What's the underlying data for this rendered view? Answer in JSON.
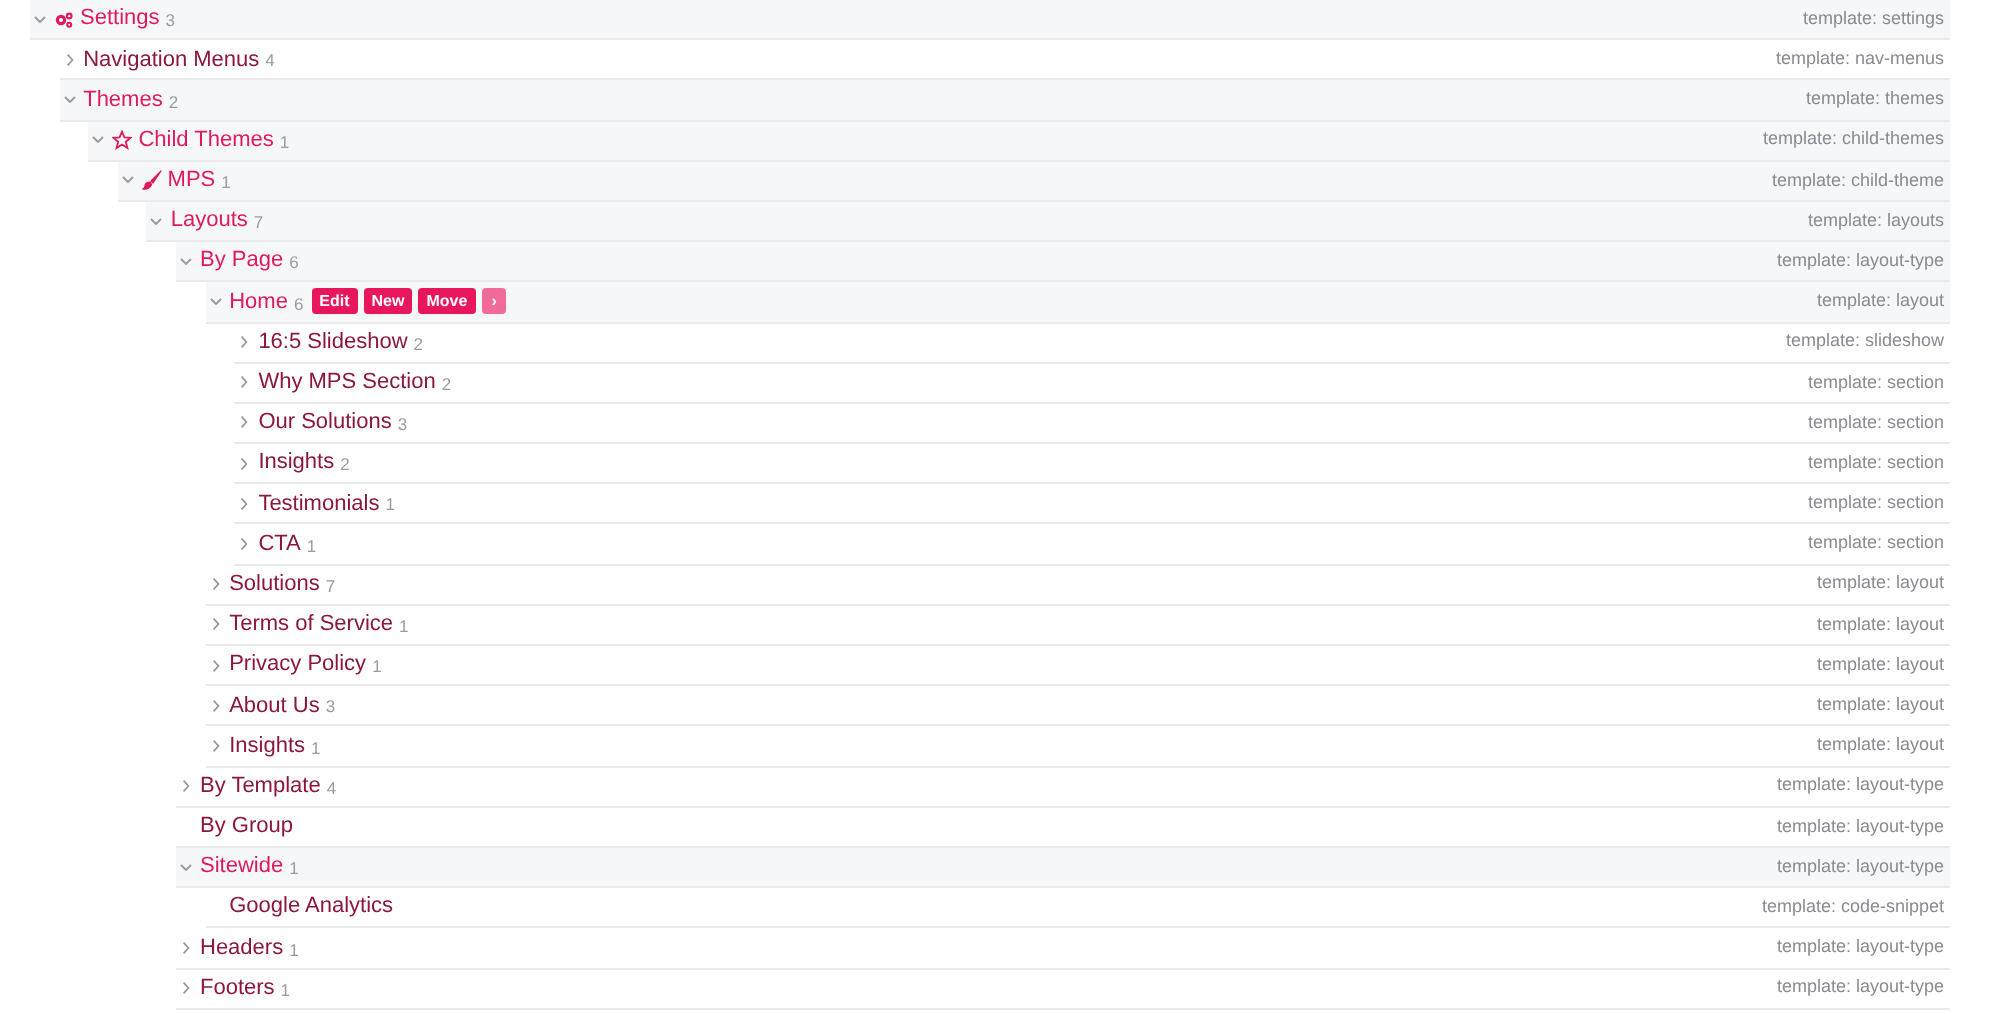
{
  "tree": [
    {
      "label": "Settings",
      "count": "3",
      "template": "template: settings",
      "kind": "gears",
      "expanded": true,
      "children": [
        {
          "label": "Navigation Menus",
          "count": "4",
          "template": "template: nav-menus",
          "kind": "branch",
          "expanded": false
        },
        {
          "label": "Themes",
          "count": "2",
          "template": "template: themes",
          "kind": "branch",
          "expanded": true,
          "children": [
            {
              "label": "Child Themes",
              "count": "1",
              "template": "template: child-themes",
              "kind": "star",
              "expanded": true,
              "children": [
                {
                  "label": "MPS",
                  "count": "1",
                  "template": "template: child-theme",
                  "kind": "brush",
                  "expanded": true,
                  "children": [
                    {
                      "label": "Layouts",
                      "count": "7",
                      "template": "template: layouts",
                      "kind": "branch",
                      "expanded": true,
                      "children": [
                        {
                          "label": "By Page",
                          "count": "6",
                          "template": "template: layout-type",
                          "kind": "branch",
                          "expanded": true,
                          "children": [
                            {
                              "label": "Home",
                              "count": "6",
                              "template": "template: layout",
                              "kind": "branch",
                              "expanded": true,
                              "actions": [
                                {
                                  "label": "Edit",
                                  "kind": "primary"
                                },
                                {
                                  "label": "New",
                                  "kind": "primary"
                                },
                                {
                                  "label": "Move",
                                  "kind": "primary"
                                },
                                {
                                  "label": "›",
                                  "kind": "more"
                                }
                              ],
                              "children": [
                                {
                                  "label": "16:5 Slideshow",
                                  "count": "2",
                                  "template": "template: slideshow",
                                  "kind": "branch",
                                  "expanded": false
                                },
                                {
                                  "label": "Why MPS Section",
                                  "count": "2",
                                  "template": "template: section",
                                  "kind": "branch",
                                  "expanded": false
                                },
                                {
                                  "label": "Our Solutions",
                                  "count": "3",
                                  "template": "template: section",
                                  "kind": "branch",
                                  "expanded": false
                                },
                                {
                                  "label": "Insights",
                                  "count": "2",
                                  "template": "template: section",
                                  "kind": "branch",
                                  "expanded": false
                                },
                                {
                                  "label": "Testimonials",
                                  "count": "1",
                                  "template": "template: section",
                                  "kind": "branch",
                                  "expanded": false
                                },
                                {
                                  "label": "CTA",
                                  "count": "1",
                                  "template": "template: section",
                                  "kind": "branch",
                                  "expanded": false
                                }
                              ]
                            },
                            {
                              "label": "Solutions",
                              "count": "7",
                              "template": "template: layout",
                              "kind": "branch",
                              "expanded": false
                            },
                            {
                              "label": "Terms of Service",
                              "count": "1",
                              "template": "template: layout",
                              "kind": "branch",
                              "expanded": false
                            },
                            {
                              "label": "Privacy Policy",
                              "count": "1",
                              "template": "template: layout",
                              "kind": "branch",
                              "expanded": false
                            },
                            {
                              "label": "About Us",
                              "count": "3",
                              "template": "template: layout",
                              "kind": "branch",
                              "expanded": false
                            },
                            {
                              "label": "Insights",
                              "count": "1",
                              "template": "template: layout",
                              "kind": "branch",
                              "expanded": false
                            }
                          ]
                        },
                        {
                          "label": "By Template",
                          "count": "4",
                          "template": "template: layout-type",
                          "kind": "branch",
                          "expanded": false
                        },
                        {
                          "label": "By Group",
                          "template": "template: layout-type",
                          "kind": "leaf"
                        },
                        {
                          "label": "Sitewide",
                          "count": "1",
                          "template": "template: layout-type",
                          "kind": "branch",
                          "expanded": true,
                          "children": [
                            {
                              "label": "Google Analytics",
                              "template": "template: code-snippet",
                              "kind": "leaf"
                            }
                          ]
                        },
                        {
                          "label": "Headers",
                          "count": "1",
                          "template": "template: layout-type",
                          "kind": "branch",
                          "expanded": false
                        },
                        {
                          "label": "Footers",
                          "count": "1",
                          "template": "template: layout-type",
                          "kind": "branch",
                          "expanded": false
                        }
                      ]
                    }
                  ]
                }
              ]
            }
          ]
        }
      ]
    }
  ]
}
